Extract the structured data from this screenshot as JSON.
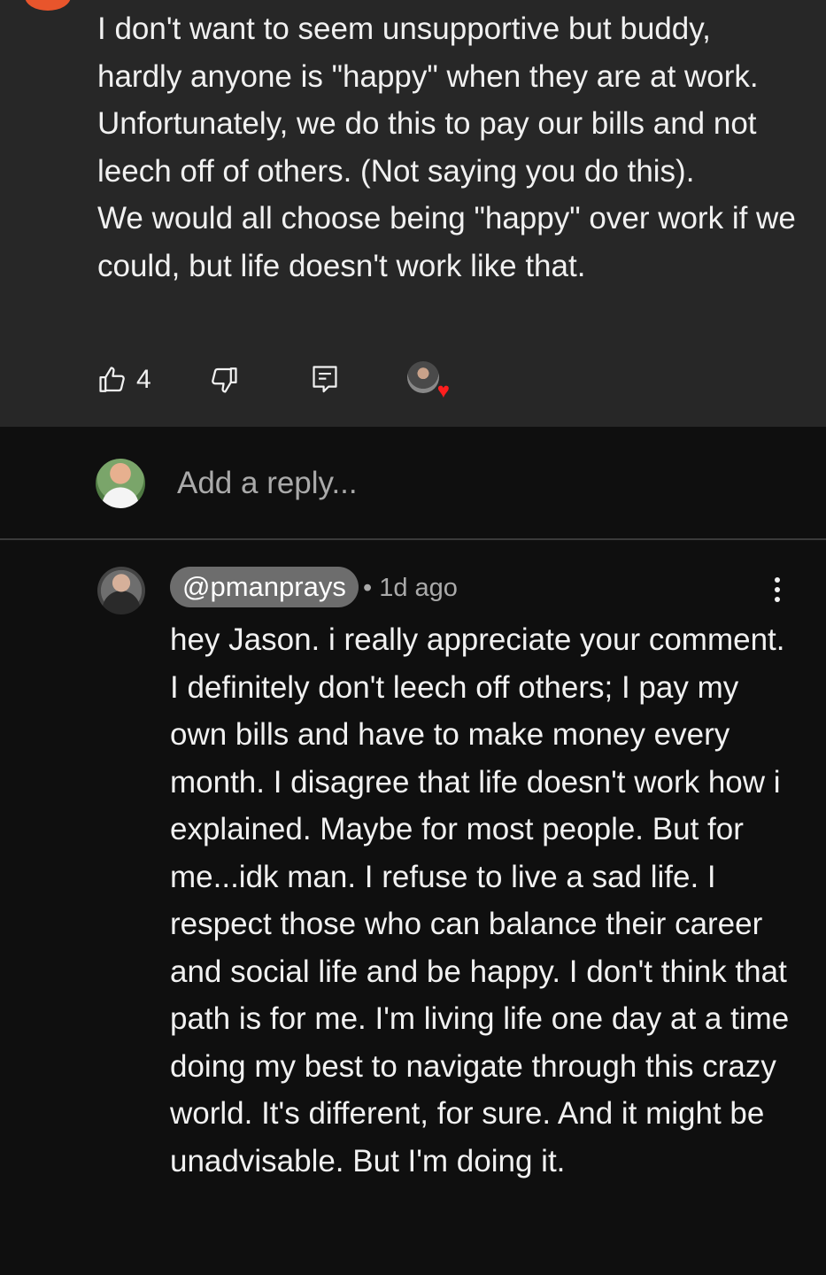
{
  "highlighted_comment": {
    "text": "I don't want to seem unsupportive but buddy, hardly anyone is \"happy\" when they are at work.  Unfortunately, we do this to pay our bills and not leech off of others. (Not saying you do this).\nWe would all choose being \"happy\" over work if we could, but life doesn't work like that.",
    "like_count": "4",
    "icons": [
      "thumbs-up-icon",
      "thumbs-down-icon",
      "reply-icon",
      "creator-heart-icon"
    ],
    "avatar_color": "#e8552c"
  },
  "reply_box": {
    "placeholder": "Add a reply..."
  },
  "reply_comment": {
    "author": "@pmanprays",
    "meta": "• 1d ago",
    "text": "hey Jason. i really appreciate your comment. I definitely don't leech off others; I pay my own bills and have to make money every month. I disagree that life doesn't work how i explained. Maybe for most people. But for me...idk man. I refuse to live a sad life. I respect those who can balance their career and social life and be happy. I don't think that path is for me. I'm living life one day at a time doing my best to navigate through this crazy world. It's different, for sure. And it might be unadvisable. But I'm doing it.",
    "icons": [
      "more-vert-icon"
    ]
  },
  "colors": {
    "background": "#0f0f0f",
    "highlight_background": "#272727",
    "text": "#f1f1f1",
    "secondary_text": "#aaaaaa",
    "author_chip": "#6d6d6d",
    "heart": "#ff1e1e"
  }
}
